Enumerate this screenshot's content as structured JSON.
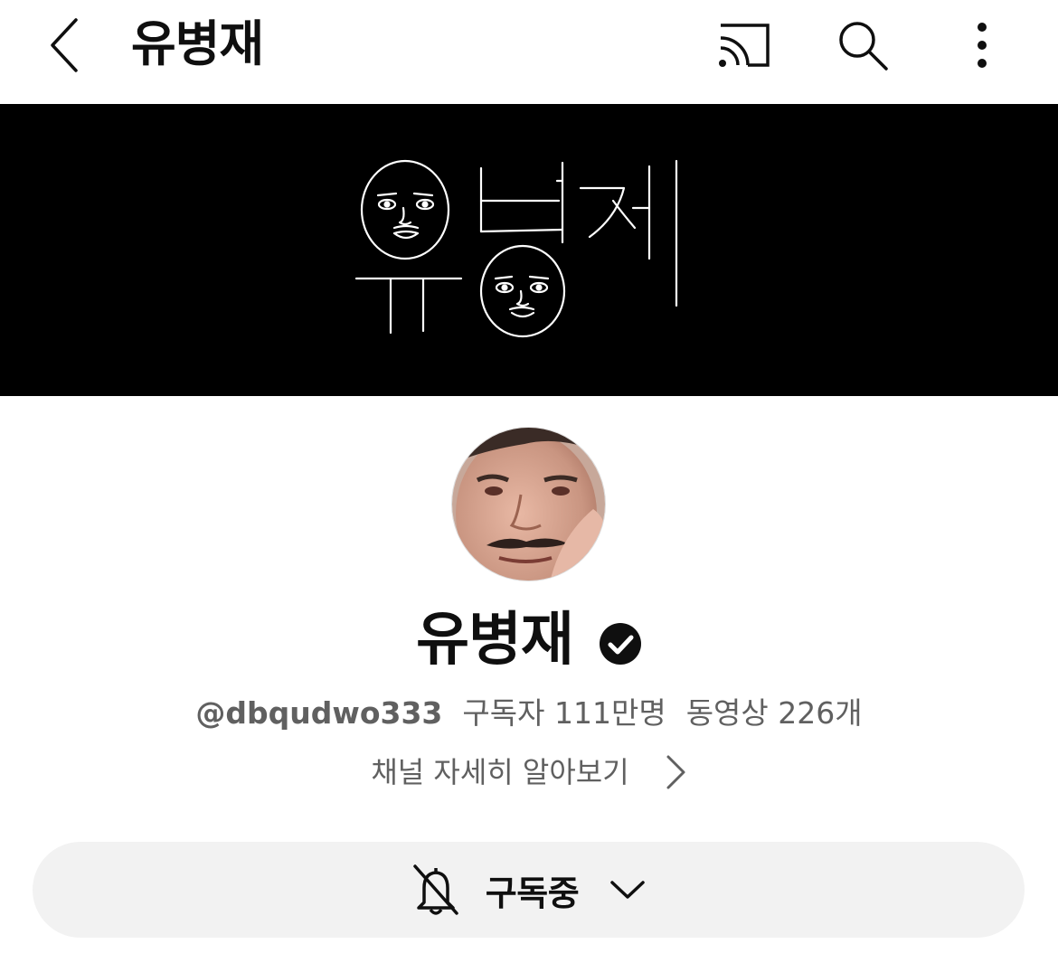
{
  "header": {
    "title": "유병재",
    "icons": [
      "back-chevron-icon",
      "cast-icon",
      "search-icon",
      "more-vertical-icon"
    ]
  },
  "banner": {
    "text": "유병재",
    "background": "#000000"
  },
  "channel": {
    "name": "유병재",
    "verified": true,
    "handle": "@dbqudwo333",
    "subscribers": "구독자 111만명",
    "videos": "동영상 226개",
    "about_link": "채널 자세히 알아보기"
  },
  "subscribe_button": {
    "label": "구독중",
    "icon": "bell-off-icon",
    "dropdown_icon": "chevron-down-icon"
  }
}
